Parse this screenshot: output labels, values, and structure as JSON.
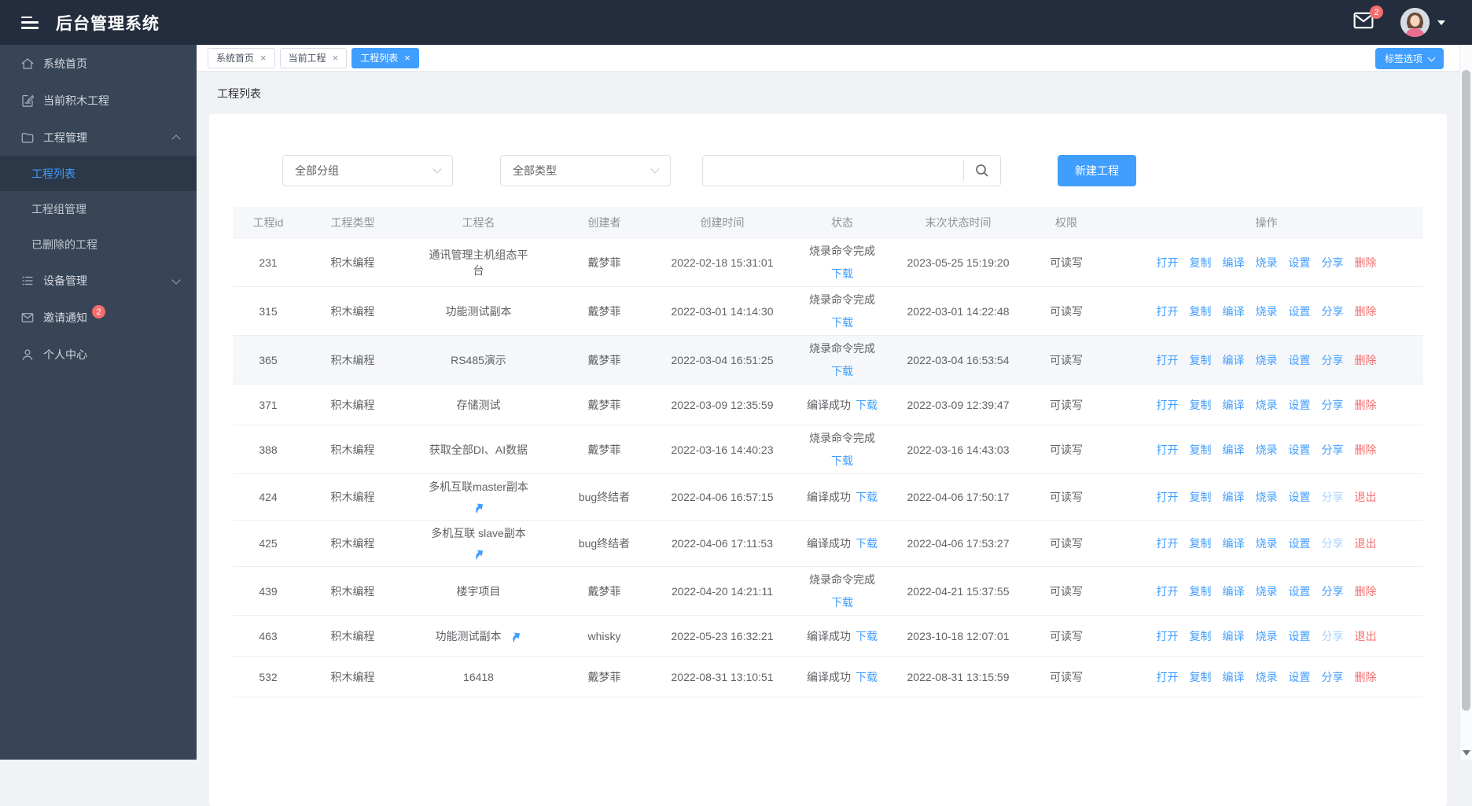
{
  "app": {
    "title": "后台管理系统"
  },
  "topbar": {
    "message_badge": "2"
  },
  "colors": {
    "primary": "#409EFF",
    "danger": "#F56C6C",
    "disabled_link": "#a8d3ff",
    "topbar_bg": "#232d3d",
    "sidebar_bg": "#384557",
    "sidebar_active_bg": "#2c3747",
    "badge": "#f56c6c",
    "table_header_bg": "#f5f7fa",
    "table_border": "#ebeef5"
  },
  "sidebar": {
    "items": [
      {
        "key": "home",
        "label": "系统首页",
        "icon": "home-icon"
      },
      {
        "key": "current-block-project",
        "label": "当前积木工程",
        "icon": "document-edit-icon"
      },
      {
        "key": "project-management",
        "label": "工程管理",
        "icon": "folder-icon",
        "expanded": true,
        "children": [
          {
            "key": "project-list",
            "label": "工程列表",
            "active": true
          },
          {
            "key": "project-group-management",
            "label": "工程组管理",
            "active": false
          },
          {
            "key": "deleted-projects",
            "label": "已删除的工程",
            "active": false
          }
        ]
      },
      {
        "key": "device-management",
        "label": "设备管理",
        "icon": "list-icon",
        "collapsed": true
      },
      {
        "key": "invite-notice",
        "label": "邀请通知",
        "icon": "mail-icon",
        "badge": "2"
      },
      {
        "key": "profile",
        "label": "个人中心",
        "icon": "user-icon"
      }
    ]
  },
  "tabs": [
    {
      "label": "系统首页",
      "active": false
    },
    {
      "label": "当前工程",
      "active": false
    },
    {
      "label": "工程列表",
      "active": true
    }
  ],
  "tag_options": {
    "label": "标签选项"
  },
  "page": {
    "breadcrumb": "工程列表"
  },
  "filters": {
    "group_select": "全部分组",
    "type_select": "全部类型",
    "search_value": "",
    "new_project_button": "新建工程"
  },
  "table": {
    "columns": [
      "工程id",
      "工程类型",
      "工程名",
      "创建者",
      "创建时间",
      "状态",
      "末次状态时间",
      "权限",
      "操作"
    ],
    "download_label": "下载",
    "action_labels": [
      "打开",
      "复制",
      "编译",
      "烧录",
      "设置",
      "分享"
    ],
    "rows": [
      {
        "id": "231",
        "type": "积木编程",
        "name": "通讯管理主机组态平台",
        "shared_icon": "none",
        "creator": "戴梦菲",
        "created": "2022-02-18 15:31:01",
        "status": "烧录命令完成",
        "status_layout": "stacked",
        "last_status_time": "2023-05-25 15:19:20",
        "permission": "可读写",
        "share_disabled": false,
        "last_action": "删除",
        "highlight": false
      },
      {
        "id": "315",
        "type": "积木编程",
        "name": "功能测试副本",
        "shared_icon": "none",
        "creator": "戴梦菲",
        "created": "2022-03-01 14:14:30",
        "status": "烧录命令完成",
        "status_layout": "stacked",
        "last_status_time": "2022-03-01 14:22:48",
        "permission": "可读写",
        "share_disabled": false,
        "last_action": "删除",
        "highlight": false
      },
      {
        "id": "365",
        "type": "积木编程",
        "name": "RS485演示",
        "shared_icon": "none",
        "creator": "戴梦菲",
        "created": "2022-03-04 16:51:25",
        "status": "烧录命令完成",
        "status_layout": "stacked",
        "last_status_time": "2022-03-04 16:53:54",
        "permission": "可读写",
        "share_disabled": false,
        "last_action": "删除",
        "highlight": true
      },
      {
        "id": "371",
        "type": "积木编程",
        "name": "存储测试",
        "shared_icon": "none",
        "creator": "戴梦菲",
        "created": "2022-03-09 12:35:59",
        "status": "编译成功",
        "status_layout": "inline",
        "last_status_time": "2022-03-09 12:39:47",
        "permission": "可读写",
        "share_disabled": false,
        "last_action": "删除",
        "highlight": false
      },
      {
        "id": "388",
        "type": "积木编程",
        "name": "获取全部DI、AI数据",
        "shared_icon": "none",
        "creator": "戴梦菲",
        "created": "2022-03-16 14:40:23",
        "status": "烧录命令完成",
        "status_layout": "stacked",
        "last_status_time": "2022-03-16 14:43:03",
        "permission": "可读写",
        "share_disabled": false,
        "last_action": "删除",
        "highlight": false
      },
      {
        "id": "424",
        "type": "积木编程",
        "name": "多机互联master副本",
        "shared_icon": "below",
        "creator": "bug终结者",
        "created": "2022-04-06 16:57:15",
        "status": "编译成功",
        "status_layout": "inline",
        "last_status_time": "2022-04-06 17:50:17",
        "permission": "可读写",
        "share_disabled": true,
        "last_action": "退出",
        "highlight": false
      },
      {
        "id": "425",
        "type": "积木编程",
        "name": "多机互联 slave副本",
        "shared_icon": "below",
        "creator": "bug终结者",
        "created": "2022-04-06 17:11:53",
        "status": "编译成功",
        "status_layout": "inline",
        "last_status_time": "2022-04-06 17:53:27",
        "permission": "可读写",
        "share_disabled": true,
        "last_action": "退出",
        "highlight": false
      },
      {
        "id": "439",
        "type": "积木编程",
        "name": "楼宇项目",
        "shared_icon": "none",
        "creator": "戴梦菲",
        "created": "2022-04-20 14:21:11",
        "status": "烧录命令完成",
        "status_layout": "stacked",
        "last_status_time": "2022-04-21 15:37:55",
        "permission": "可读写",
        "share_disabled": false,
        "last_action": "删除",
        "highlight": false
      },
      {
        "id": "463",
        "type": "积木编程",
        "name": "功能测试副本",
        "shared_icon": "inline",
        "creator": "whisky",
        "created": "2022-05-23 16:32:21",
        "status": "编译成功",
        "status_layout": "inline",
        "last_status_time": "2023-10-18 12:07:01",
        "permission": "可读写",
        "share_disabled": true,
        "last_action": "退出",
        "highlight": false
      },
      {
        "id": "532",
        "type": "积木编程",
        "name": "16418",
        "shared_icon": "none",
        "creator": "戴梦菲",
        "created": "2022-08-31 13:10:51",
        "status": "编译成功",
        "status_layout": "inline",
        "last_status_time": "2022-08-31 13:15:59",
        "permission": "可读写",
        "share_disabled": false,
        "last_action": "删除",
        "highlight": false
      }
    ]
  }
}
